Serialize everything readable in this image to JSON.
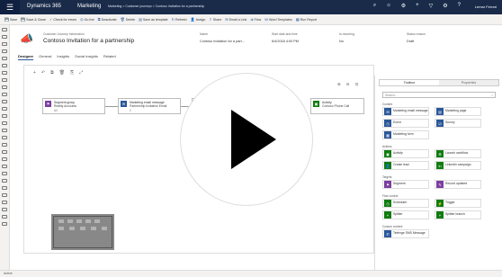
{
  "topbar": {
    "brand": "Dynamics 365",
    "app": "Marketing",
    "breadcrumb": "Marketing  >  Customer journeys  >  Contoso Invitation for a partnership",
    "icons": [
      "search-icon",
      "lightbulb-icon",
      "gear-icon",
      "plus-icon",
      "filter-icon",
      "settings-icon",
      "help-icon"
    ],
    "user": "Lemar Ferrari"
  },
  "commands": [
    {
      "icon": "save-icon",
      "label": "Save"
    },
    {
      "icon": "save-close-icon",
      "label": "Save & Close"
    },
    {
      "icon": "check-icon",
      "label": "Check for errors"
    },
    {
      "icon": "go-live-icon",
      "label": "Go live"
    },
    {
      "icon": "copy-icon",
      "label": "Deactivate"
    },
    {
      "icon": "delete-icon",
      "label": "Delete"
    },
    {
      "icon": "template-icon",
      "label": "Save as template"
    },
    {
      "icon": "refresh-icon",
      "label": "Refresh"
    },
    {
      "icon": "assign-icon",
      "label": "Assign"
    },
    {
      "icon": "share-icon",
      "label": "Share"
    },
    {
      "icon": "email-link-icon",
      "label": "Email a Link"
    },
    {
      "icon": "flow-icon",
      "label": "Flow"
    },
    {
      "icon": "word-icon",
      "label": "Word Templates"
    },
    {
      "icon": "report-icon",
      "label": "Run Report"
    }
  ],
  "header": {
    "subtitle": "Customer Journey Information",
    "title": "Contoso Invitation for a partnership",
    "fields": [
      {
        "label": "Name",
        "value": "Contoso Invitation for a part..."
      },
      {
        "label": "Start date and time",
        "value": "6/4/2018   4:00 PM"
      },
      {
        "label": "Is recurring",
        "value": "No"
      },
      {
        "label": "Status reason",
        "value": "Draft"
      }
    ]
  },
  "tabs": [
    "Designer",
    "General",
    "Insights",
    "Social Insights",
    "Related"
  ],
  "canvas": {
    "tiles": [
      {
        "title": "Segment group",
        "subtitle": "Reality Accounts",
        "meta": "All",
        "color": "#7b3f9e",
        "icon": "segment-icon"
      },
      {
        "title": "Marketing email message",
        "subtitle": "Partnership Invitation Email",
        "meta": "0",
        "color": "#2b579a",
        "icon": "email-icon"
      },
      {
        "title": "Activity",
        "subtitle": "Contoso Phone Call",
        "meta": "",
        "color": "#107c10",
        "icon": "activity-icon"
      }
    ],
    "minimap_blocks": 10
  },
  "toolbox": {
    "tabs": [
      "Toolbox",
      "Properties"
    ],
    "search_placeholder": "Search...",
    "groups": [
      {
        "name": "Content",
        "items": [
          {
            "label": "Marketing email message",
            "color": "#2b579a",
            "icon": "email-icon"
          },
          {
            "label": "Marketing page",
            "color": "#2b579a",
            "icon": "page-icon"
          },
          {
            "label": "Event",
            "color": "#2b579a",
            "icon": "event-icon"
          },
          {
            "label": "Survey",
            "color": "#2b579a",
            "icon": "survey-icon"
          },
          {
            "label": "Marketing form",
            "color": "#2b579a",
            "icon": "form-icon"
          }
        ]
      },
      {
        "name": "Actions",
        "items": [
          {
            "label": "Activity",
            "color": "#107c10",
            "icon": "activity-icon"
          },
          {
            "label": "Launch workflow",
            "color": "#107c10",
            "icon": "workflow-icon"
          },
          {
            "label": "Create lead",
            "color": "#107c10",
            "icon": "lead-icon"
          },
          {
            "label": "LinkedIn campaign",
            "color": "#107c10",
            "icon": "linkedin-icon"
          }
        ]
      },
      {
        "name": "Targets",
        "items": [
          {
            "label": "Segment",
            "color": "#7b3f9e",
            "icon": "segment-icon"
          },
          {
            "label": "Record updated",
            "color": "#7b3f9e",
            "icon": "record-icon"
          }
        ]
      },
      {
        "name": "Flow control",
        "items": [
          {
            "label": "Scheduler",
            "color": "#107c10",
            "icon": "scheduler-icon"
          },
          {
            "label": "Trigger",
            "color": "#107c10",
            "icon": "trigger-icon"
          },
          {
            "label": "Splitter",
            "color": "#107c10",
            "icon": "splitter-icon"
          },
          {
            "label": "Splitter branch",
            "color": "#107c10",
            "icon": "splitter-branch-icon"
          }
        ]
      },
      {
        "name": "Custom content",
        "items": [
          {
            "label": "Teleinge SMS Message",
            "color": "#2b579a",
            "icon": "sms-icon"
          }
        ]
      }
    ]
  },
  "status": "Active",
  "overlay": {
    "icon": "play-icon"
  }
}
